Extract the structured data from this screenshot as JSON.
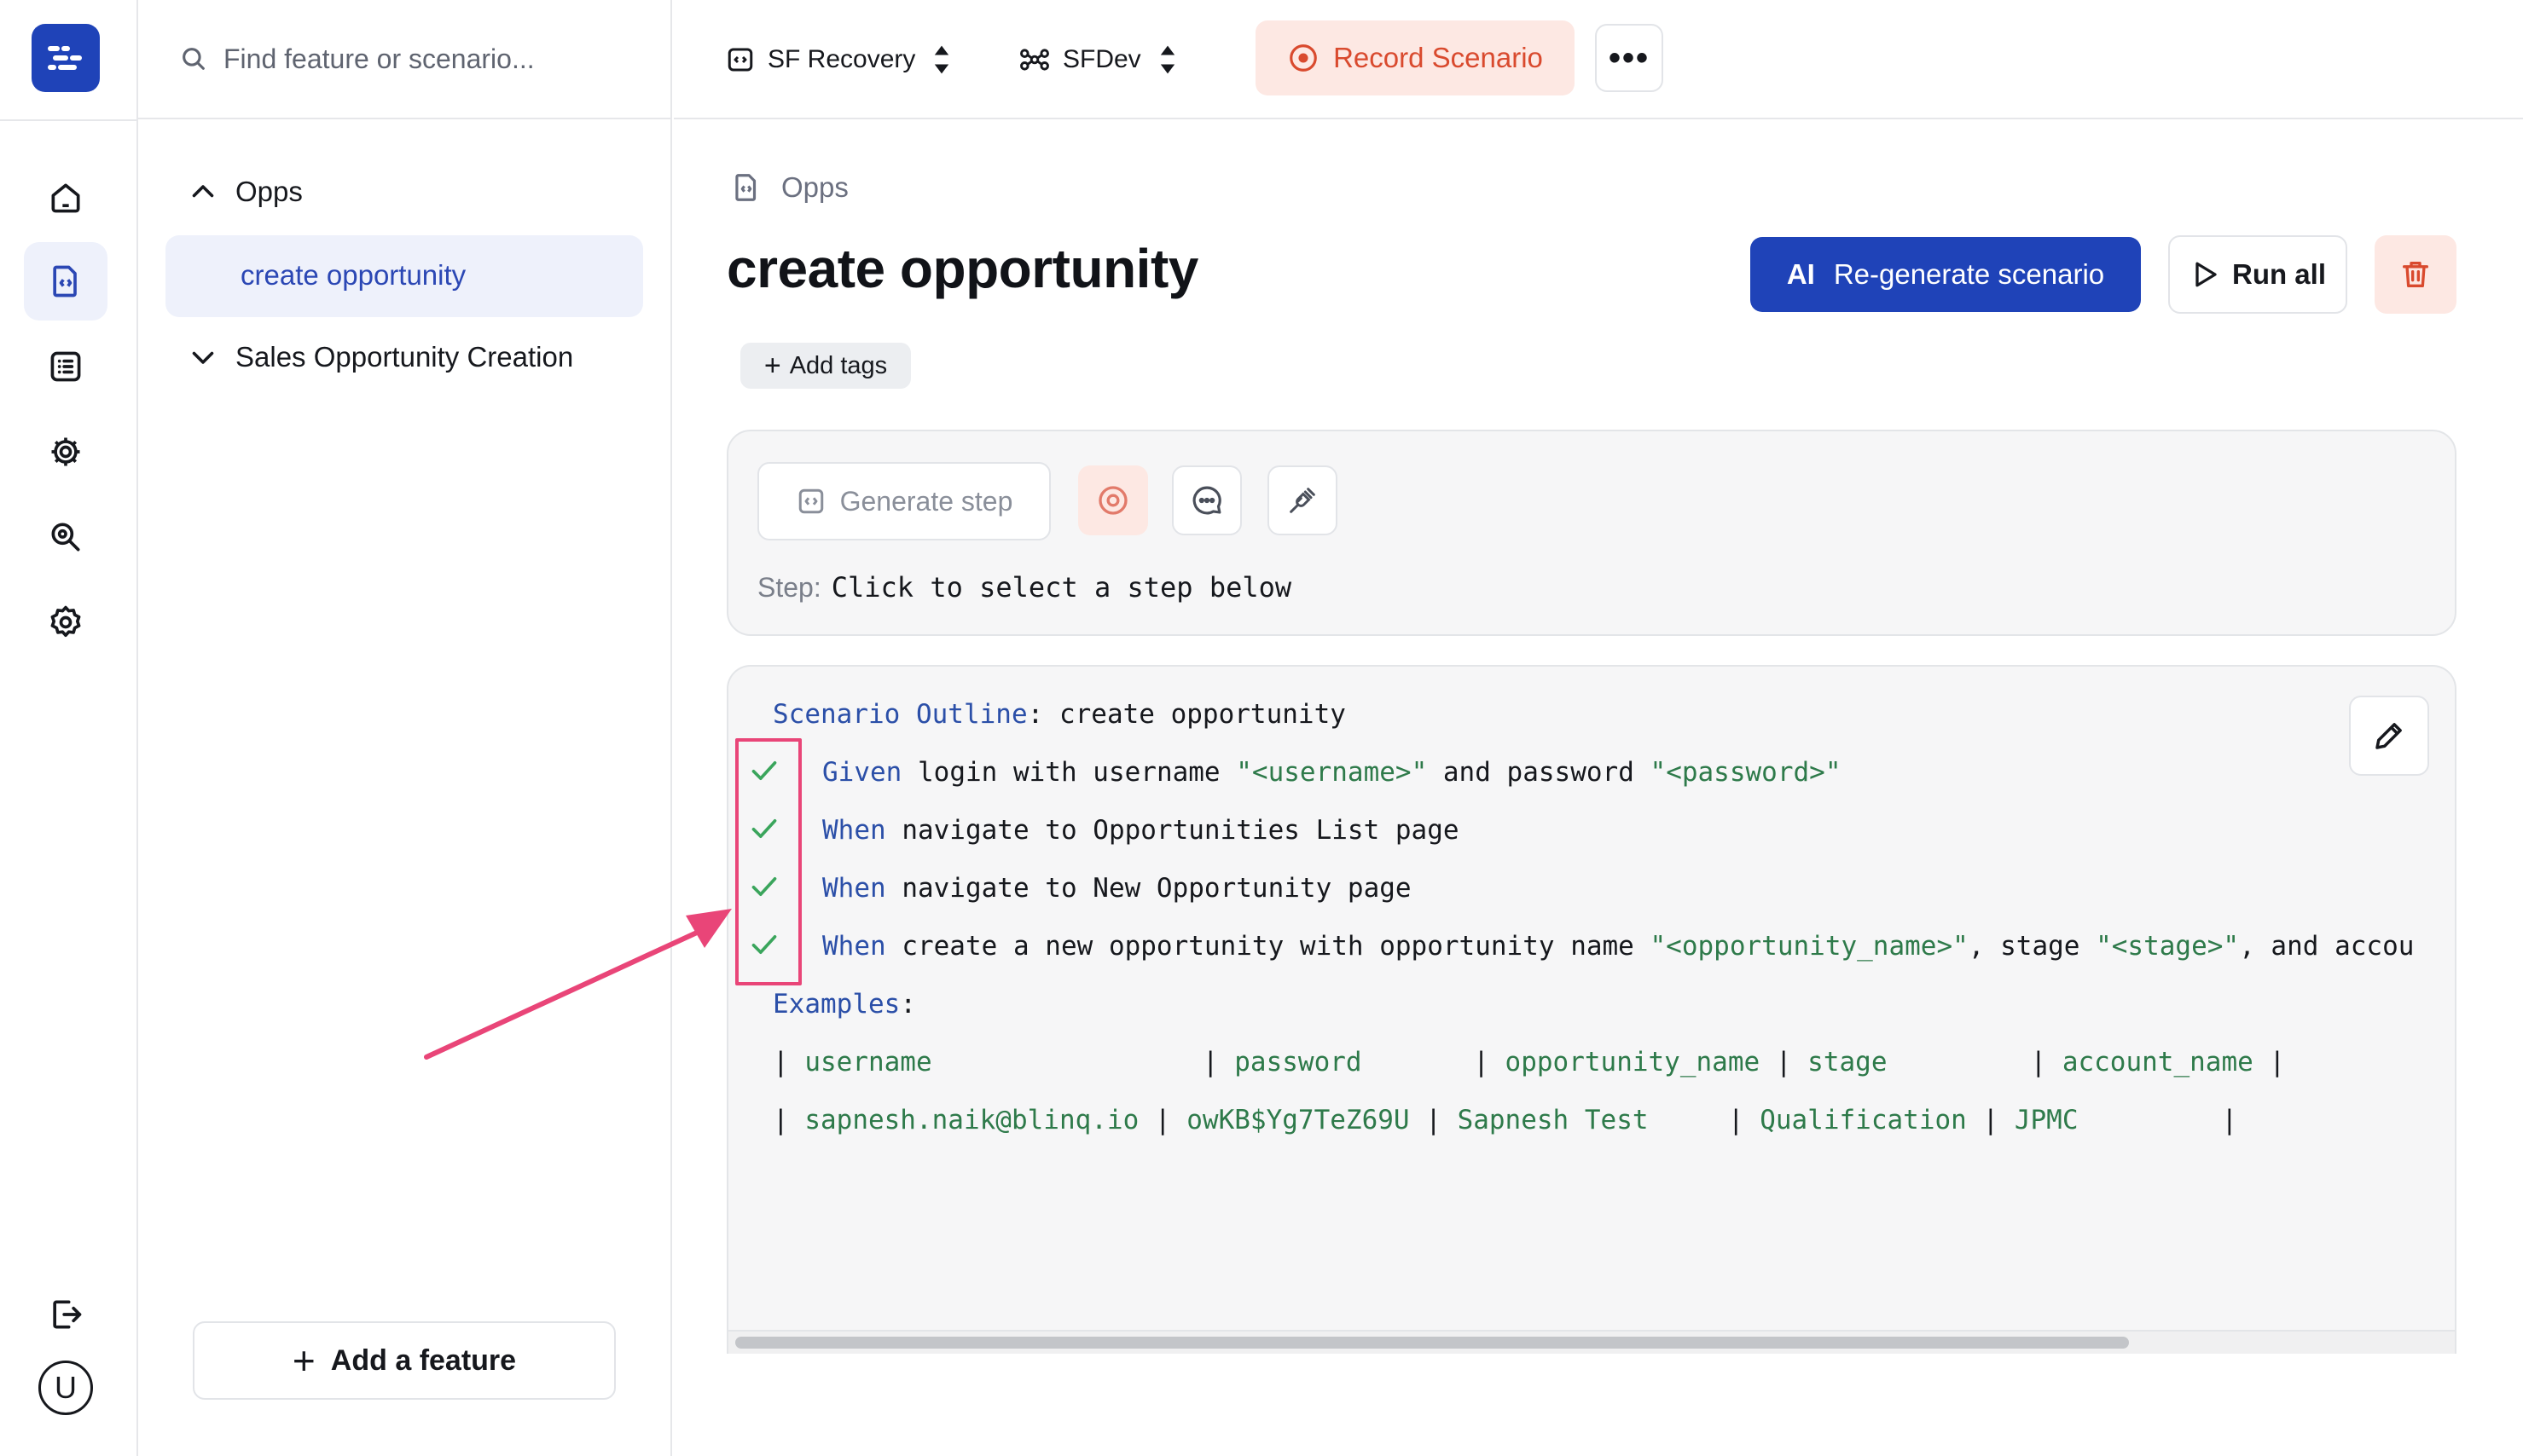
{
  "app": {
    "accent_color": "#1f43b8",
    "record_color": "#d94a2e",
    "string_color": "#2e7a4a",
    "keyword_color": "#2b4fa8",
    "annotation_color": "#e94578"
  },
  "rail": {
    "items": [
      {
        "icon": "home-icon"
      },
      {
        "icon": "scenario-file-icon",
        "active": true
      },
      {
        "icon": "list-icon"
      },
      {
        "icon": "gear-chip-icon"
      },
      {
        "icon": "search-key-icon"
      },
      {
        "icon": "settings-icon"
      }
    ],
    "logout_icon": "logout-icon",
    "avatar_letter": "U"
  },
  "sidebar": {
    "search_placeholder": "Find feature or scenario...",
    "tree": [
      {
        "label": "Opps",
        "expanded": true,
        "children": [
          "create opportunity"
        ]
      },
      {
        "label": "Sales Opportunity Creation",
        "expanded": false
      }
    ],
    "add_feature_label": "Add a feature"
  },
  "topbar": {
    "project_label": "SF Recovery",
    "env_label": "SFDev",
    "record_label": "Record Scenario",
    "more_label": "•••"
  },
  "main": {
    "breadcrumb": "Opps",
    "title": "create opportunity",
    "regen_ai": "AI",
    "regen_label": "Re-generate scenario",
    "run_all_label": "Run all",
    "add_tags_label": "Add tags",
    "generate_step_label": "Generate step",
    "step_label": "Step:",
    "step_value": "Click to select a step below"
  },
  "editor": {
    "scenario_keyword": "Scenario Outline",
    "scenario_name": "create opportunity",
    "steps": [
      {
        "keyword": "Given",
        "parts": [
          " login with username ",
          "\"<username>\"",
          " and password ",
          "\"<password>\""
        ],
        "passed": true
      },
      {
        "keyword": "When",
        "parts": [
          " navigate to Opportunities List page"
        ],
        "passed": true
      },
      {
        "keyword": "When",
        "parts": [
          " navigate to New Opportunity page"
        ],
        "passed": true
      },
      {
        "keyword": "When",
        "parts": [
          " create a new opportunity with opportunity name ",
          "\"<opportunity_name>\"",
          ", stage ",
          "\"<stage>\"",
          ", and accou"
        ],
        "passed": true
      }
    ],
    "examples_keyword": "Examples",
    "table": {
      "header": [
        "username",
        "password",
        "opportunity_name",
        "stage",
        "account_name"
      ],
      "rows": [
        [
          "sapnesh.naik@blinq.io",
          "owKB$Yg7TeZ69U",
          "Sapnesh Test",
          "Qualification",
          "JPMC"
        ]
      ]
    }
  }
}
